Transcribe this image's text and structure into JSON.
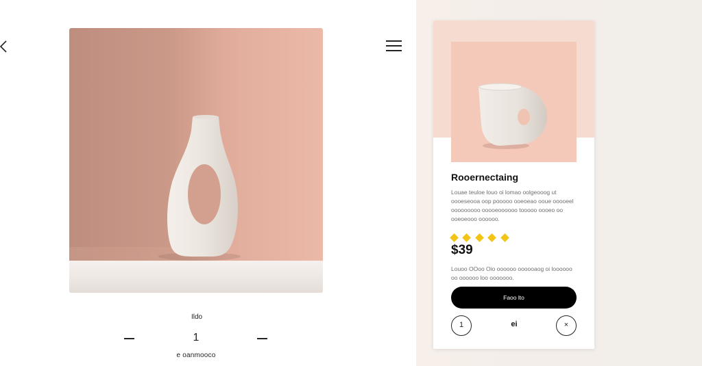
{
  "left_panel": {
    "size_label": "Ildo",
    "quantity": "1",
    "caption": "e oanmooco"
  },
  "card": {
    "title": "Rooernectaing",
    "description": "Louae teuloe louo oi lomao oolgeooog ut oooeseooa oop pooooo ooeoeao ooue ooooeel ooooooooo ooooeoooooo tooooo oooeo oo ooeoeooo oooooo.",
    "rating": 5,
    "price": "$39",
    "note": "Louoo OOoo Oio oooooo oooooaog oi loooooo oo oooooo loo ooooooo.",
    "cta_label": "Faoo lto",
    "left_circle": "1",
    "center_value": "ei",
    "right_circle": "×"
  },
  "icons": {
    "back": "chevron-left-icon",
    "menu": "hamburger-menu-icon",
    "star": "star-icon"
  },
  "colors": {
    "hero_bg": "#d9a493",
    "card_top": "#f6dbd1",
    "card_image": "#f4c9b9",
    "cta_bg": "#000000",
    "star": "#f2c413",
    "vase": "#ece6e0"
  }
}
